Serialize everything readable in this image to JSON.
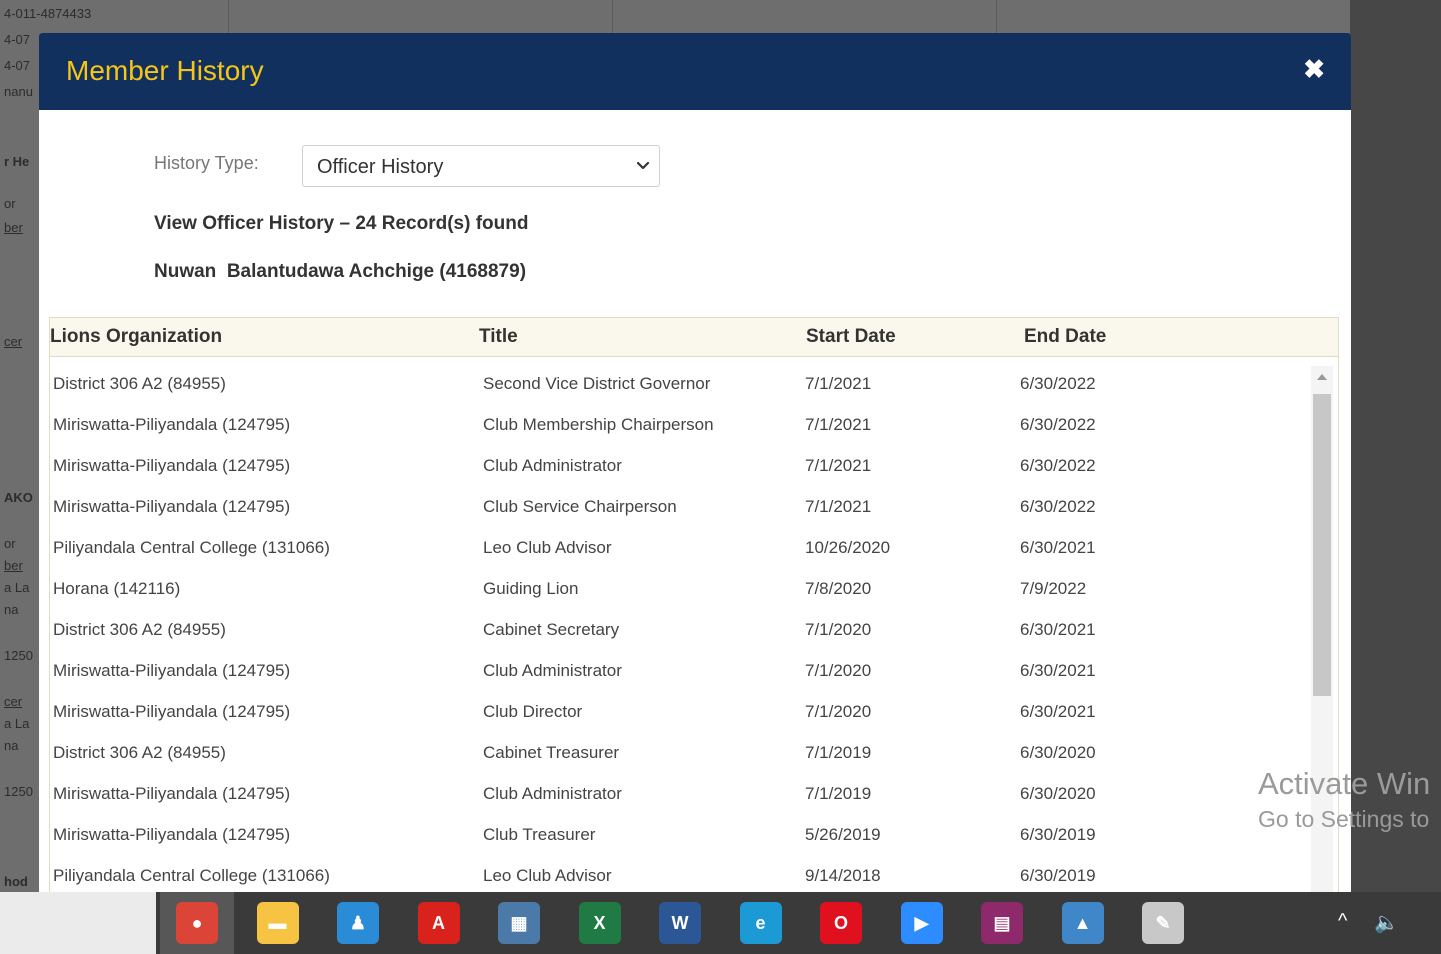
{
  "background": {
    "snippets": [
      "4-011-4874433",
      "4-07",
      "4-07",
      "nanu",
      "r He",
      "or",
      "ber",
      "cer",
      "AKO",
      "or",
      "ber",
      "a La",
      "na",
      "1250",
      "cer",
      "a La",
      "na",
      "1250",
      "hod"
    ]
  },
  "modal": {
    "title": "Member History",
    "close_glyph": "✖",
    "filter": {
      "label": "History Type:",
      "selected": "Officer History"
    },
    "summary": "View Officer History – 24 Record(s) found",
    "member": "Nuwan  Balantudawa Achchige (4168879)"
  },
  "table": {
    "columns": [
      "Lions Organization",
      "Title",
      "Start Date",
      "End Date"
    ],
    "rows": [
      [
        "District 306 A2 (84955)",
        "Second Vice District Governor",
        "7/1/2021",
        "6/30/2022"
      ],
      [
        "Miriswatta-Piliyandala (124795)",
        "Club Membership Chairperson",
        "7/1/2021",
        "6/30/2022"
      ],
      [
        "Miriswatta-Piliyandala (124795)",
        "Club Administrator",
        "7/1/2021",
        "6/30/2022"
      ],
      [
        "Miriswatta-Piliyandala (124795)",
        "Club Service Chairperson",
        "7/1/2021",
        "6/30/2022"
      ],
      [
        "Piliyandala Central College (131066)",
        "Leo Club Advisor",
        "10/26/2020",
        "6/30/2021"
      ],
      [
        "Horana (142116)",
        "Guiding Lion",
        "7/8/2020",
        "7/9/2022"
      ],
      [
        "District 306 A2 (84955)",
        "Cabinet Secretary",
        "7/1/2020",
        "6/30/2021"
      ],
      [
        "Miriswatta-Piliyandala (124795)",
        "Club Administrator",
        "7/1/2020",
        "6/30/2021"
      ],
      [
        "Miriswatta-Piliyandala (124795)",
        "Club Director",
        "7/1/2020",
        "6/30/2021"
      ],
      [
        "District 306 A2 (84955)",
        "Cabinet Treasurer",
        "7/1/2019",
        "6/30/2020"
      ],
      [
        "Miriswatta-Piliyandala (124795)",
        "Club Administrator",
        "7/1/2019",
        "6/30/2020"
      ],
      [
        "Miriswatta-Piliyandala (124795)",
        "Club Treasurer",
        "5/26/2019",
        "6/30/2019"
      ],
      [
        "Piliyandala Central College (131066)",
        "Leo Club Advisor",
        "9/14/2018",
        "6/30/2019"
      ]
    ]
  },
  "watermark": {
    "line1": "Activate Win",
    "line2": "Go to Settings to"
  },
  "taskbar": {
    "apps": [
      {
        "name": "chrome-icon",
        "glyph": "●",
        "color": "#db4437"
      },
      {
        "name": "file-explorer-icon",
        "glyph": "▬",
        "color": "#f6c343"
      },
      {
        "name": "people-icon",
        "glyph": "♟",
        "color": "#2a8bd6"
      },
      {
        "name": "pdf-reader-icon",
        "glyph": "A",
        "color": "#d9221c"
      },
      {
        "name": "calculator-icon",
        "glyph": "▦",
        "color": "#4c7aa8"
      },
      {
        "name": "excel-icon",
        "glyph": "X",
        "color": "#1f7a43"
      },
      {
        "name": "word-icon",
        "glyph": "W",
        "color": "#2b5797"
      },
      {
        "name": "edge-icon",
        "glyph": "e",
        "color": "#1c9ad6"
      },
      {
        "name": "opera-icon",
        "glyph": "O",
        "color": "#e0101e"
      },
      {
        "name": "zoom-icon",
        "glyph": "▶",
        "color": "#2d8cff"
      },
      {
        "name": "archive-icon",
        "glyph": "▤",
        "color": "#8e2a6b"
      },
      {
        "name": "photos-icon",
        "glyph": "▲",
        "color": "#3f87c8"
      },
      {
        "name": "paint-icon",
        "glyph": "✎",
        "color": "#c8c8c8"
      }
    ],
    "tray": {
      "chevron": "^",
      "volume": "🔈"
    }
  }
}
